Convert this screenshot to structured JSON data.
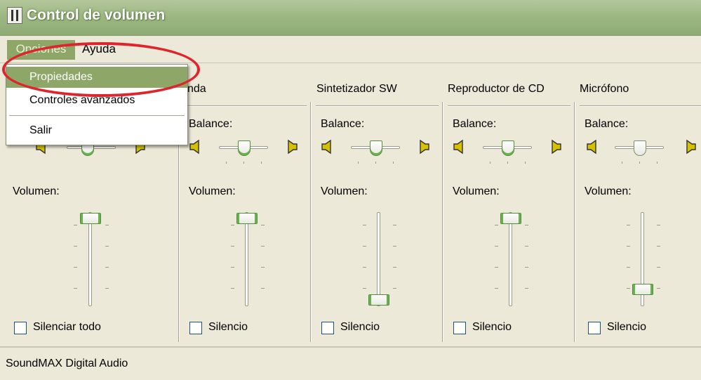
{
  "window": {
    "title": "Control de volumen",
    "icon": "mixer-app-icon"
  },
  "menubar": {
    "items": [
      {
        "label": "Opciones"
      },
      {
        "label": "Ayuda"
      }
    ]
  },
  "dropdown": {
    "items": [
      {
        "label": "Propiedades"
      },
      {
        "label": "Controles avanzados"
      },
      {
        "label": "Salir"
      }
    ]
  },
  "annotation": {
    "color": "#e0242b"
  },
  "channels": [
    {
      "name": "",
      "balance_label": "",
      "volume_label": "Volumen:",
      "balance_position": 0.5,
      "volume_level": 1.0,
      "mute_label": "Silenciar todo",
      "muted": false
    },
    {
      "name": "nda",
      "balance_label": "Balance:",
      "volume_label": "Volumen:",
      "balance_position": 0.5,
      "volume_level": 1.0,
      "mute_label": "Silencio",
      "muted": false
    },
    {
      "name": "Sintetizador SW",
      "balance_label": "Balance:",
      "volume_label": "Volumen:",
      "balance_position": 0.5,
      "volume_level": 0.0,
      "mute_label": "Silencio",
      "muted": false
    },
    {
      "name": "Reproductor de CD",
      "balance_label": "Balance:",
      "volume_label": "Volumen:",
      "balance_position": 0.5,
      "volume_level": 1.0,
      "mute_label": "Silencio",
      "muted": false
    },
    {
      "name": "Micrófono",
      "balance_label": "Balance:",
      "volume_label": "Volumen:",
      "balance_position": 0.5,
      "volume_level": 0.15,
      "mute_label": "Silencio",
      "muted": false
    }
  ],
  "statusbar": {
    "text": "SoundMAX Digital Audio"
  },
  "colors": {
    "titlebar": "#9db782",
    "menu_highlight": "#8ea768",
    "face": "#ece9d8",
    "thumb_accent": "#6ab04f"
  }
}
